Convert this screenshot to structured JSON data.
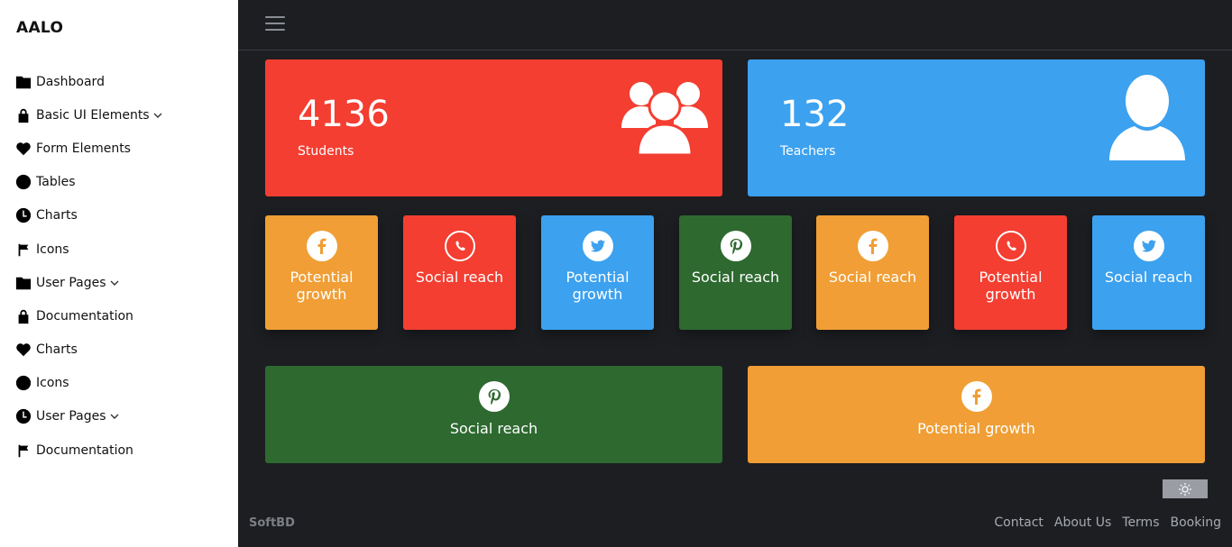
{
  "brand": "AALO",
  "sidebar": {
    "items": [
      {
        "label": "Dashboard",
        "icon": "folder-icon",
        "caret": false
      },
      {
        "label": "Basic UI Elements",
        "icon": "lock-icon",
        "caret": true
      },
      {
        "label": "Form Elements",
        "icon": "heart-icon",
        "caret": false
      },
      {
        "label": "Tables",
        "icon": "circle-icon",
        "caret": false
      },
      {
        "label": "Charts",
        "icon": "clock-icon",
        "caret": false
      },
      {
        "label": "Icons",
        "icon": "flag-icon",
        "caret": false
      },
      {
        "label": "User Pages",
        "icon": "folder-icon",
        "caret": true
      },
      {
        "label": "Documentation",
        "icon": "lock-icon",
        "caret": false
      },
      {
        "label": "Charts",
        "icon": "heart-icon",
        "caret": false
      },
      {
        "label": "Icons",
        "icon": "circle-icon",
        "caret": false
      },
      {
        "label": "User Pages",
        "icon": "clock-icon",
        "caret": true
      },
      {
        "label": "Documentation",
        "icon": "flag-icon",
        "caret": false
      }
    ]
  },
  "stats": {
    "students": {
      "value": "4136",
      "label": "Students",
      "color": "#f33e31"
    },
    "teachers": {
      "value": "132",
      "label": "Teachers",
      "color": "#3ca1ef"
    }
  },
  "tiles": [
    {
      "label": "Potential growth",
      "icon": "facebook-icon",
      "color": "#f09e35"
    },
    {
      "label": "Social reach",
      "icon": "whatsapp-icon",
      "color": "#f33e31"
    },
    {
      "label": "Potential growth",
      "icon": "twitter-icon",
      "color": "#3ca1ef"
    },
    {
      "label": "Social reach",
      "icon": "pinterest-icon",
      "color": "#2e6930"
    },
    {
      "label": "Social reach",
      "icon": "facebook-icon",
      "color": "#f09e35"
    },
    {
      "label": "Potential growth",
      "icon": "whatsapp-icon",
      "color": "#f33e31"
    },
    {
      "label": "Social reach",
      "icon": "twitter-icon",
      "color": "#3ca1ef"
    }
  ],
  "wide_tiles": [
    {
      "label": "Social reach",
      "icon": "pinterest-icon",
      "color": "#2e6930"
    },
    {
      "label": "Potential growth",
      "icon": "facebook-icon",
      "color": "#f09e35"
    }
  ],
  "footer": {
    "brand": "SoftBD",
    "links": [
      "Contact",
      "About Us",
      "Terms",
      "Booking"
    ]
  }
}
